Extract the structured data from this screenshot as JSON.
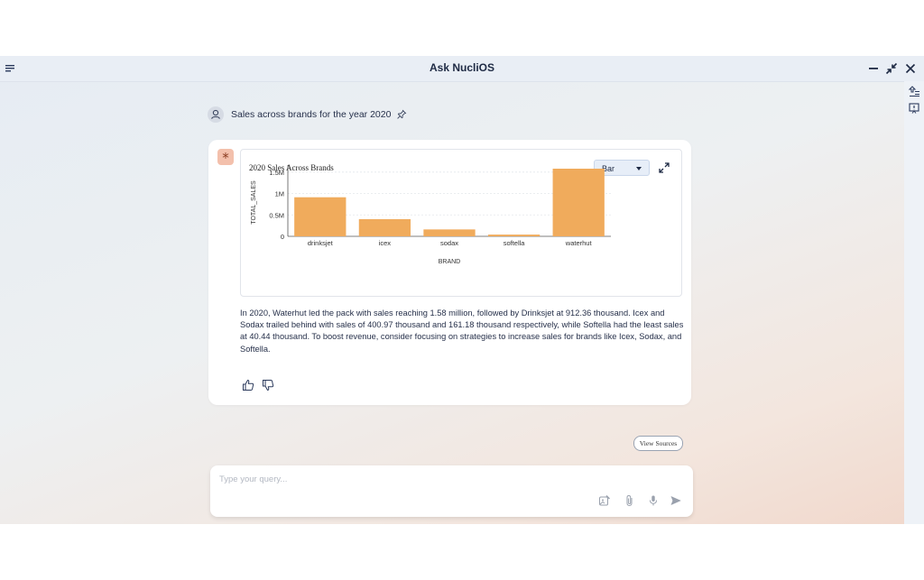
{
  "app": {
    "title": "Ask NucliOS"
  },
  "conversation": {
    "user_query": "Sales across brands for the year 2020",
    "bot_badge": "*"
  },
  "chart_card": {
    "title": "2020 Sales Across Brands",
    "chart_type_selected": "Bar",
    "accent": "#f0ab5c"
  },
  "chart_data": {
    "type": "bar",
    "title": "2020 Sales Across Brands",
    "categories": [
      "drinksjet",
      "icex",
      "sodax",
      "softella",
      "waterhut"
    ],
    "values": [
      912360,
      400970,
      161180,
      40440,
      1580000
    ],
    "xlabel": "BRAND",
    "ylabel": "TOTAL_SALES",
    "ylim": [
      0,
      1580000
    ],
    "yticks": [
      0,
      500000,
      1000000,
      1500000
    ],
    "ytick_labels": [
      "0",
      "0.5M",
      "1M",
      "1.5M"
    ],
    "grid": true,
    "legend": "none"
  },
  "summary": "In 2020, Waterhut led the pack with sales reaching 1.58 million, followed by Drinksjet at 912.36 thousand. Icex and Sodax trailed behind with sales of 400.97 thousand and 161.18 thousand respectively, while Softella had the least sales at 40.44 thousand. To boost revenue, consider focusing on strategies to increase sales for brands like Icex, Sodax, and Softella.",
  "actions": {
    "view_sources": "View Sources"
  },
  "query": {
    "placeholder": "Type your query...",
    "value": ""
  },
  "icons": {
    "menu": "hamburger-icon",
    "minimize": "minimize-icon",
    "collapse": "collapse-arrows-icon",
    "close": "close-icon",
    "pin": "pin-icon",
    "thumbs_up": "thumbs-up-icon",
    "thumbs_down": "thumbs-down-icon",
    "attach": "paperclip-icon",
    "mic": "mic-icon",
    "send": "send-icon"
  }
}
